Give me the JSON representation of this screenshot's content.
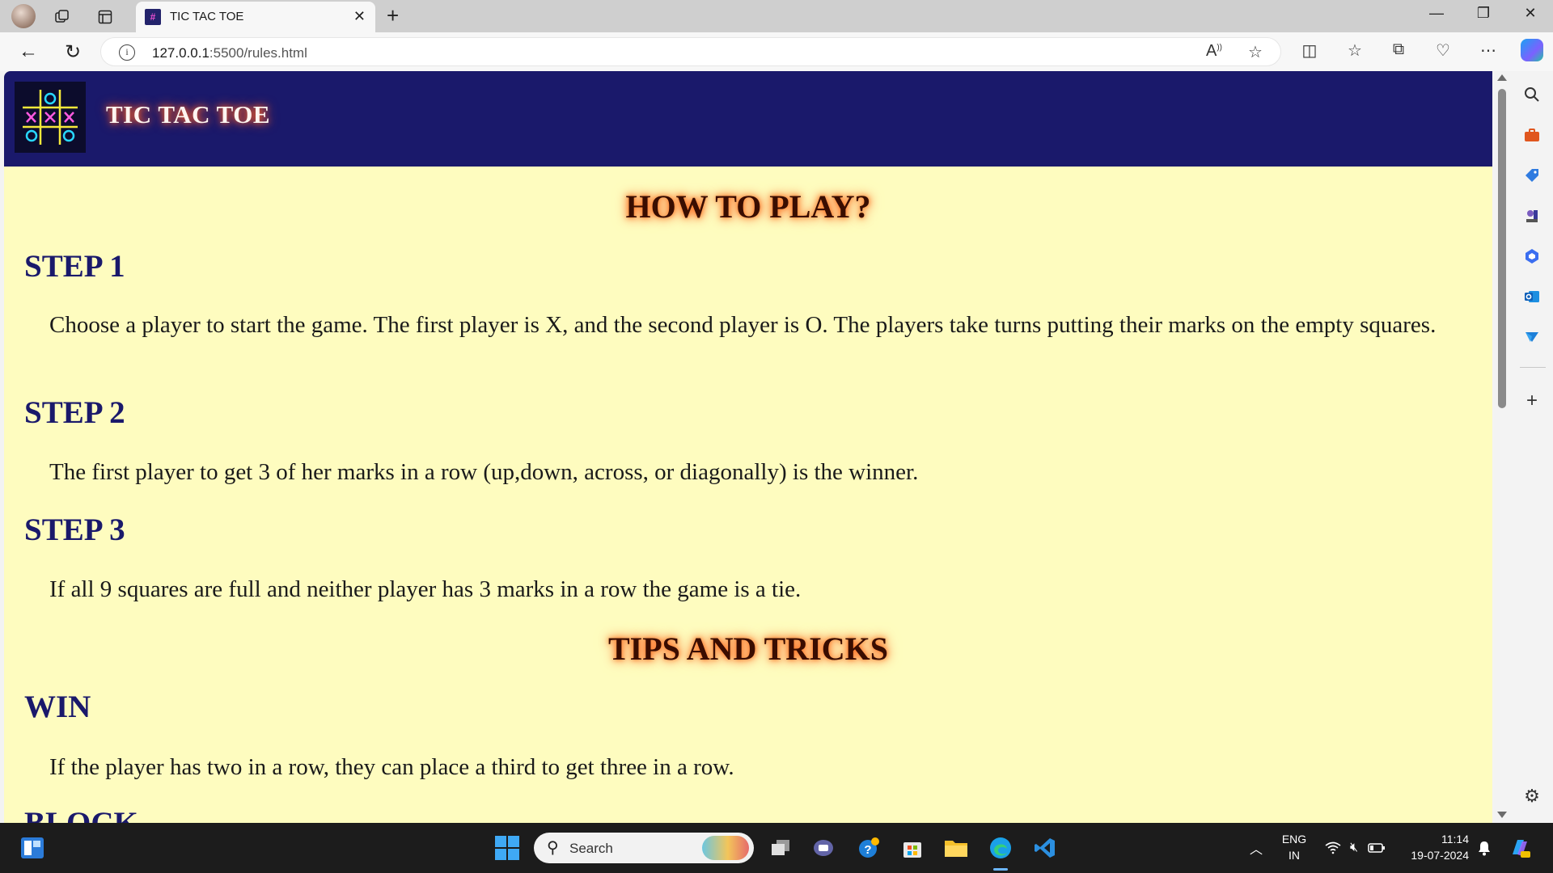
{
  "browser": {
    "tab_title": "TIC TAC TOE",
    "url_host": "127.0.0.1",
    "url_path": ":5500/rules.html"
  },
  "site": {
    "title": "TIC TAC TOE"
  },
  "content": {
    "how_to_play_title": "HOW TO PLAY?",
    "steps": [
      {
        "heading": "STEP 1",
        "text": "Choose a player to start the game. The first player is X, and the second player is O. The players take turns putting their marks on the empty squares."
      },
      {
        "heading": "STEP 2",
        "text": "The first player to get 3 of her marks in a row (up,down, across, or diagonally) is the winner."
      },
      {
        "heading": "STEP 3",
        "text": "If all 9 squares are full and neither player has 3 marks in a row the game is a tie."
      }
    ],
    "tips_title": "TIPS AND TRICKS",
    "tips": [
      {
        "heading": "WIN",
        "text": "If the player has two in a row, they can place a third to get three in a row."
      }
    ],
    "cut_heading": "BLOCK"
  },
  "taskbar": {
    "search_label": "Search",
    "lang_top": "ENG",
    "lang_bottom": "IN",
    "time": "11:14",
    "date": "19-07-2024"
  },
  "colors": {
    "header_bg": "#1a196b",
    "page_bg": "#fefcbf",
    "heading_color": "#1a196b",
    "glow": "#ff6a2a"
  }
}
